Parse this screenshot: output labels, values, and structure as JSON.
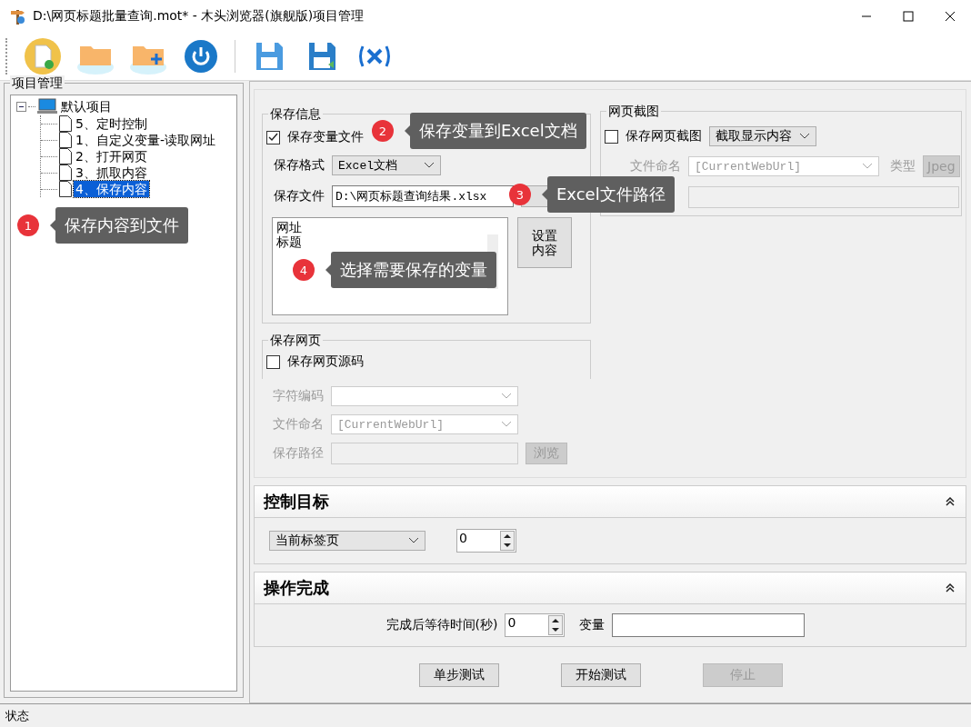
{
  "window": {
    "title": "D:\\网页标题批量查询.mot* - 木头浏览器(旗舰版)项目管理"
  },
  "project_panel": {
    "title": "项目管理",
    "tree": {
      "label": "默认项目",
      "expanded": true,
      "children": [
        {
          "label": "5、定时控制",
          "selected": false
        },
        {
          "label": "1、自定义变量-读取网址",
          "selected": false
        },
        {
          "label": "2、打开网页",
          "selected": false
        },
        {
          "label": "3、抓取内容",
          "selected": false
        },
        {
          "label": "4、保存内容",
          "selected": true
        }
      ]
    }
  },
  "save_info": {
    "title": "保存信息",
    "save_variable_file": {
      "label": "保存变量文件",
      "checked": true
    },
    "format": {
      "label": "保存格式",
      "value": "Excel文档"
    },
    "file": {
      "label": "保存文件",
      "value": "D:\\网页标题查询结果.xlsx"
    },
    "variables": [
      "网址",
      "标题"
    ],
    "set_content_button": "设置内容"
  },
  "save_page": {
    "title": "保存网页",
    "save_source": {
      "label": "保存网页源码",
      "checked": false
    },
    "encoding": {
      "label": "字符编码"
    },
    "file_name": {
      "label": "文件命名",
      "value": "[CurrentWebUrl]"
    },
    "path": {
      "label": "保存路径"
    },
    "browse_button": "浏览"
  },
  "screenshot": {
    "title": "网页截图",
    "save_screenshot": {
      "label": "保存网页截图",
      "checked": false
    },
    "mode": "截取显示内容",
    "file_name": {
      "label": "文件命名",
      "value": "[CurrentWebUrl]"
    },
    "type": {
      "label": "类型",
      "value": "Jpeg"
    }
  },
  "control_target": {
    "title": "控制目标",
    "tab": "当前标签页",
    "index": "0"
  },
  "completion": {
    "title": "操作完成",
    "wait": {
      "label": "完成后等待时间(秒)",
      "value": "0"
    },
    "variable": {
      "label": "变量"
    }
  },
  "buttons": [
    {
      "label": "单步测试",
      "disabled": false
    },
    {
      "label": "开始测试",
      "disabled": false
    },
    {
      "label": "停止",
      "disabled": true
    }
  ],
  "status_bar": "状态",
  "callouts": [
    {
      "number": "1",
      "text": "保存内容到文件"
    },
    {
      "number": "2",
      "text": "保存变量到Excel文档"
    },
    {
      "number": "3",
      "text": "Excel文件路径"
    },
    {
      "number": "4",
      "text": "选择需要保存的变量"
    }
  ]
}
